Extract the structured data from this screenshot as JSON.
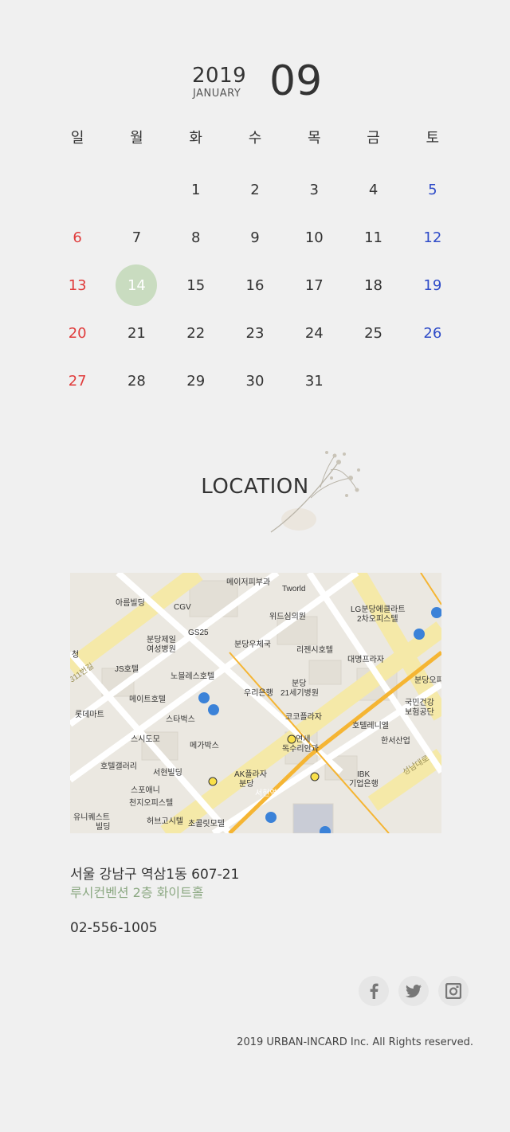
{
  "header": {
    "year": "2019",
    "month_name": "JANUARY",
    "day": "09"
  },
  "calendar": {
    "weekdays": [
      "일",
      "월",
      "화",
      "수",
      "목",
      "금",
      "토"
    ],
    "weeks": [
      [
        "",
        "",
        "1",
        "2",
        "3",
        "4",
        "5"
      ],
      [
        "6",
        "7",
        "8",
        "9",
        "10",
        "11",
        "12"
      ],
      [
        "13",
        "14",
        "15",
        "16",
        "17",
        "18",
        "19"
      ],
      [
        "20",
        "21",
        "22",
        "23",
        "24",
        "25",
        "26"
      ],
      [
        "27",
        "28",
        "29",
        "30",
        "31",
        "",
        ""
      ]
    ],
    "highlight": "14",
    "colors": {
      "sunday": "#e03c3c",
      "saturday": "#2f4cc8",
      "highlight_bg": "#c9dcc0"
    }
  },
  "location": {
    "title": "LOCATION",
    "map_labels": {
      "l1": "메이저피부과",
      "l2": "Tworld",
      "l3": "아름빌딩",
      "l4": "CGV",
      "l5": "위드심의원",
      "l6": "LG분당에클라트",
      "l7": "2차오피스텔",
      "l8": "GS25",
      "l9": "분당제일",
      "l10": "여성병원",
      "l11": "분당우체국",
      "l12": "리젠시호텔",
      "l13": "대명프라자",
      "l14": "JS호텔",
      "l15": "노블레스호텔",
      "l16": "분당",
      "l17": "21세기병원",
      "l18": "분당오피",
      "l19": "우리은행",
      "l20": "메이트호텔",
      "l21": "롯데마트",
      "l22": "스타벅스",
      "l23": "코코플라자",
      "l24": "국민건강",
      "l25": "보험공단",
      "l26": "호텔레니엘",
      "l27": "스시도모",
      "l28": "메가박스",
      "l29": "연세",
      "l30": "독수리안과",
      "l31": "한서산업",
      "l32": "호텔갤러리",
      "l33": "서현빌딩",
      "l34": "AK플라자",
      "l35": "분당",
      "l36": "IBK",
      "l37": "기업은행",
      "l38": "스포애니",
      "l39": "천지오피스텔",
      "l40": "유니퀘스트",
      "l41": "빌딩",
      "l42": "허브고시텔",
      "l43": "초콜릿모텔",
      "l44": "서현역",
      "l45": "성남대로",
      "l46": "311번길",
      "l47": "청"
    },
    "address": "서울 강남구 역삼1동 607-21",
    "venue": "루시컨벤션 2층 화이트홀",
    "phone": "02-556-1005"
  },
  "social": {
    "icons": [
      "facebook-icon",
      "twitter-icon",
      "instagram-icon"
    ]
  },
  "footer": {
    "copyright": "2019 URBAN-INCARD Inc. All Rights reserved."
  }
}
